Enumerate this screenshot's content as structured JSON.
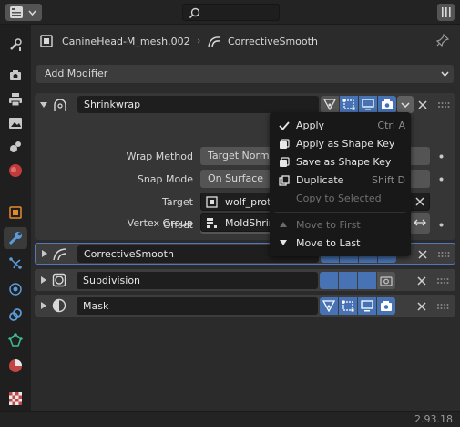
{
  "colors": {
    "accent": "#4772b3",
    "background": "#303030",
    "field": "#1e1e1e",
    "menu_bg": "#181818"
  },
  "breadcrumb": {
    "object_name": "CanineHead-M_mesh.002",
    "modifier_name": "CorrectiveSmooth"
  },
  "add_modifier": "Add Modifier",
  "modifiers": [
    {
      "name": "Shrinkwrap",
      "icon": "shrinkwrap-icon",
      "expanded": true
    },
    {
      "name": "CorrectiveSmooth",
      "icon": "corrective-smooth-icon",
      "expanded": false
    },
    {
      "name": "Subdivision",
      "icon": "subdivision-icon",
      "expanded": false
    },
    {
      "name": "Mask",
      "icon": "mask-icon",
      "expanded": false
    }
  ],
  "shrinkwrap": {
    "wrap_method_label": "Wrap Method",
    "wrap_method_value": "Target Norma",
    "snap_mode_label": "Snap Mode",
    "snap_mode_value": "On Surface",
    "target_label": "Target",
    "target_value": "wolf_prot",
    "offset_label": "Offset",
    "vertex_group_label": "Vertex Group",
    "vertex_group_value": "MoldShrin"
  },
  "context_menu": {
    "items": [
      {
        "label": "Apply",
        "shortcut": "Ctrl A",
        "icon": "checkmark-icon",
        "enabled": true
      },
      {
        "label": "Apply as Shape Key",
        "shortcut": "",
        "icon": "shape-key-icon",
        "enabled": true
      },
      {
        "label": "Save as Shape Key",
        "shortcut": "",
        "icon": "shape-key-icon",
        "enabled": true
      },
      {
        "label": "Duplicate",
        "shortcut": "Shift D",
        "icon": "duplicate-icon",
        "enabled": true
      },
      {
        "label": "Copy to Selected",
        "shortcut": "",
        "icon": "",
        "enabled": false
      },
      {
        "label": "Move to First",
        "shortcut": "",
        "icon": "triangle-up-icon",
        "enabled": false
      },
      {
        "label": "Move to Last",
        "shortcut": "",
        "icon": "triangle-down-icon",
        "enabled": true
      }
    ]
  },
  "version": "2.93.18"
}
